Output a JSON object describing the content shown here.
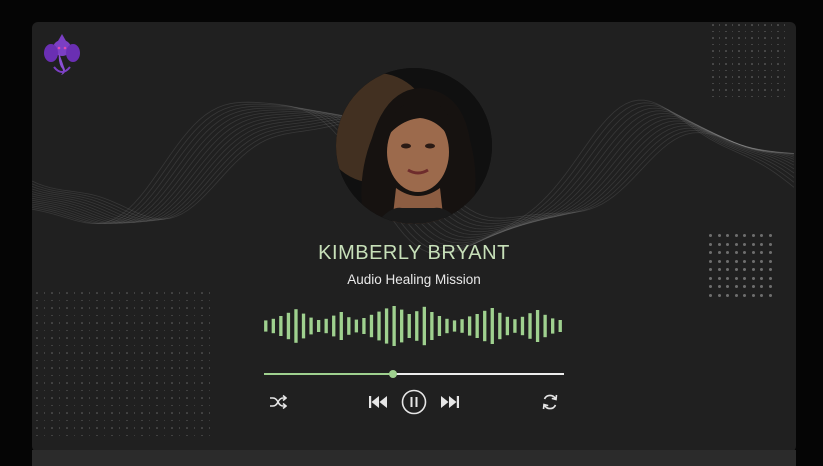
{
  "player": {
    "artist_name": "KIMBERLY BRYANT",
    "subtitle": "Audio Healing Mission",
    "progress_fraction": 0.43,
    "waveform_levels": [
      0.28,
      0.36,
      0.5,
      0.66,
      0.84,
      0.62,
      0.42,
      0.3,
      0.36,
      0.52,
      0.7,
      0.44,
      0.32,
      0.4,
      0.56,
      0.72,
      0.88,
      1.0,
      0.82,
      0.6,
      0.74,
      0.96,
      0.7,
      0.5,
      0.36,
      0.28,
      0.34,
      0.48,
      0.6,
      0.76,
      0.9,
      0.66,
      0.46,
      0.34,
      0.46,
      0.64,
      0.8,
      0.56,
      0.38,
      0.3
    ],
    "colors": {
      "accent": "#9fd18f",
      "name": "#c7e0b9",
      "subtitle": "#e9e9e9",
      "card_bg": "#202020",
      "page_bg": "#050505",
      "logo": "#7b3fc4"
    },
    "icons": {
      "logo": "ganesha-logo",
      "shuffle": "shuffle-icon",
      "previous": "skip-previous-icon",
      "play_pause": "pause-icon",
      "next": "skip-next-icon",
      "repeat": "repeat-icon"
    }
  }
}
